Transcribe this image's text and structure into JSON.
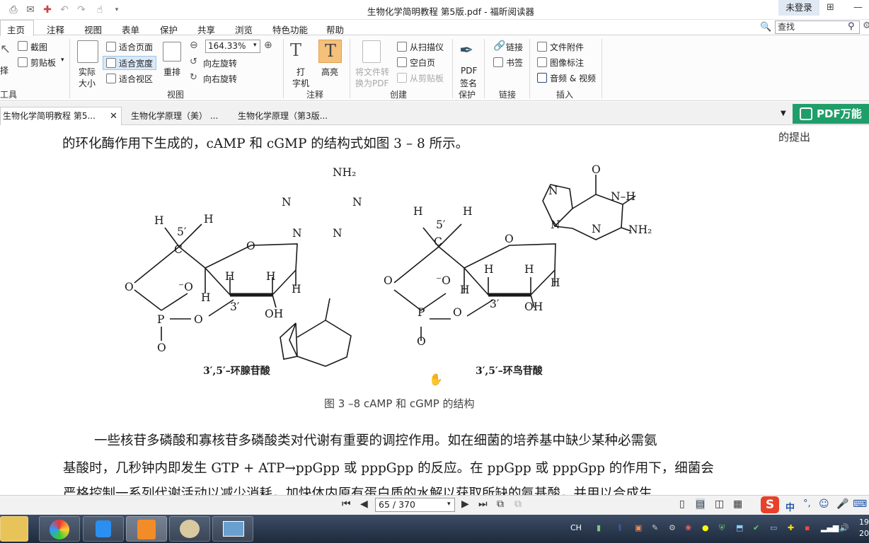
{
  "window": {
    "title": "生物化学简明教程 第5版.pdf - 福昕阅读器",
    "login": "未登录"
  },
  "menu": [
    "主页",
    "注释",
    "视图",
    "表单",
    "保护",
    "共享",
    "浏览",
    "特色功能",
    "帮助"
  ],
  "search": {
    "placeholder": "查找"
  },
  "ribbon": {
    "tools_partial": "择",
    "tools_label": "工具",
    "screenshot": "截图",
    "clipboard": "剪贴板",
    "actual_size": [
      "实际",
      "大小"
    ],
    "fit_page": "适合页面",
    "fit_width": "适合宽度",
    "fit_view": "适合视区",
    "reflow": "重排",
    "zoom": "164.33%",
    "rotate_left": "向左旋转",
    "rotate_right": "向右旋转",
    "view_label": "视图",
    "typewriter": [
      "打",
      "字机"
    ],
    "highlight": "高亮",
    "comment_label": "注释",
    "file_to_pdf": [
      "将文件转",
      "换为PDF"
    ],
    "from_scanner": "从扫描仪",
    "blank_page": "空白页",
    "from_clipboard": "从剪贴板",
    "create_label": "创建",
    "pdf_sign": [
      "PDF",
      "签名"
    ],
    "protect_label": "保护",
    "link": "链接",
    "bookmark": "书签",
    "link_label": "链接",
    "file_attachment": "文件附件",
    "image_annotation": "图像标注",
    "audio_video": "音频 & 视频",
    "insert_label": "插入"
  },
  "tabs": [
    "生物化学简明教程 第5...",
    "生物化学原理（美）  ...",
    "生物化学原理（第3版..."
  ],
  "banner": "PDF万能",
  "document": {
    "line_top": "的环化酶作用下生成的，cAMP 和 cGMP 的结构式如图 3 – 8 所示。",
    "side_note": "的提出",
    "camp_caption": "3′,5′–环腺苷酸",
    "cgmp_caption": "3′,5′–环鸟苷酸",
    "figure_caption": "图 3 –8    cAMP 和 cGMP 的结构",
    "para_line1": "一些核苷多磷酸和寡核苷多磷酸类对代谢有重要的调控作用。如在细菌的培养基中缺少某种必需氨",
    "para_line2": "基酸时，几秒钟内即发生 GTP + ATP→ppGpp 或 pppGpp 的反应。在 ppGpp 或 pppGpp 的作用下，细菌会",
    "para_line3": "严格控制一系列代谢活动以减少消耗，加快体内原有蛋白质的水解以获取所缺的氨基酸，并用以合成生",
    "chem": {
      "nh2": "NH₂",
      "N": "N",
      "O": "O",
      "H": "H",
      "C": "C",
      "P": "P",
      "OH": "OH",
      "five_prime": "5′",
      "three_prime": "3′",
      "o_minus": "⁻O",
      "n_h": "N–H"
    }
  },
  "nav": {
    "page": "65 / 370"
  },
  "ime": {
    "lang": "中",
    "tray_lang": "CH"
  },
  "clock": {
    "time": "19",
    "date": "20"
  }
}
